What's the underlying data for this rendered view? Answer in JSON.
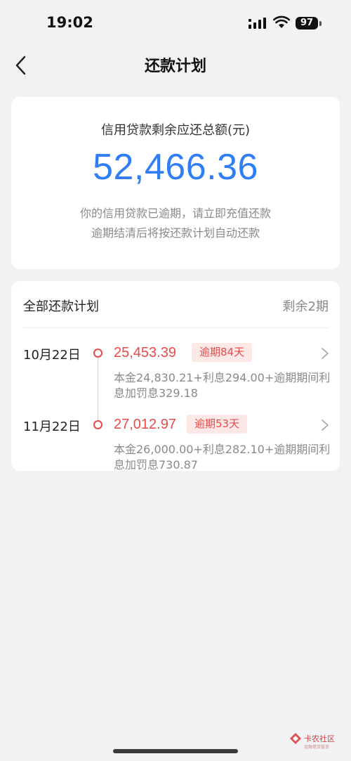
{
  "status_bar": {
    "time": "19:02",
    "battery": "97"
  },
  "nav": {
    "title": "还款计划"
  },
  "summary": {
    "label": "信用贷款剩余应还总额(元)",
    "amount": "52,466.36",
    "note_line1": "你的信用贷款已逾期，请立即充值还款",
    "note_line2": "逾期结清后将按还款计划自动还款"
  },
  "plan": {
    "title": "全部还款计划",
    "remaining": "剩余2期",
    "items": [
      {
        "date": "10月22日",
        "amount": "25,453.39",
        "badge": "逾期84天",
        "detail": "本金24,830.21+利息294.00+逾期期间利息加罚息329.18"
      },
      {
        "date": "11月22日",
        "amount": "27,012.97",
        "badge": "逾期53天",
        "detail": "本金26,000.00+利息282.10+逾期期间利息加罚息730.87"
      }
    ]
  },
  "watermark": {
    "text": "卡农社区",
    "sub": "金融借贷投资"
  },
  "colors": {
    "accent_blue": "#2f7ef5",
    "overdue_red": "#e84a4a",
    "badge_bg": "#fde8e8"
  }
}
